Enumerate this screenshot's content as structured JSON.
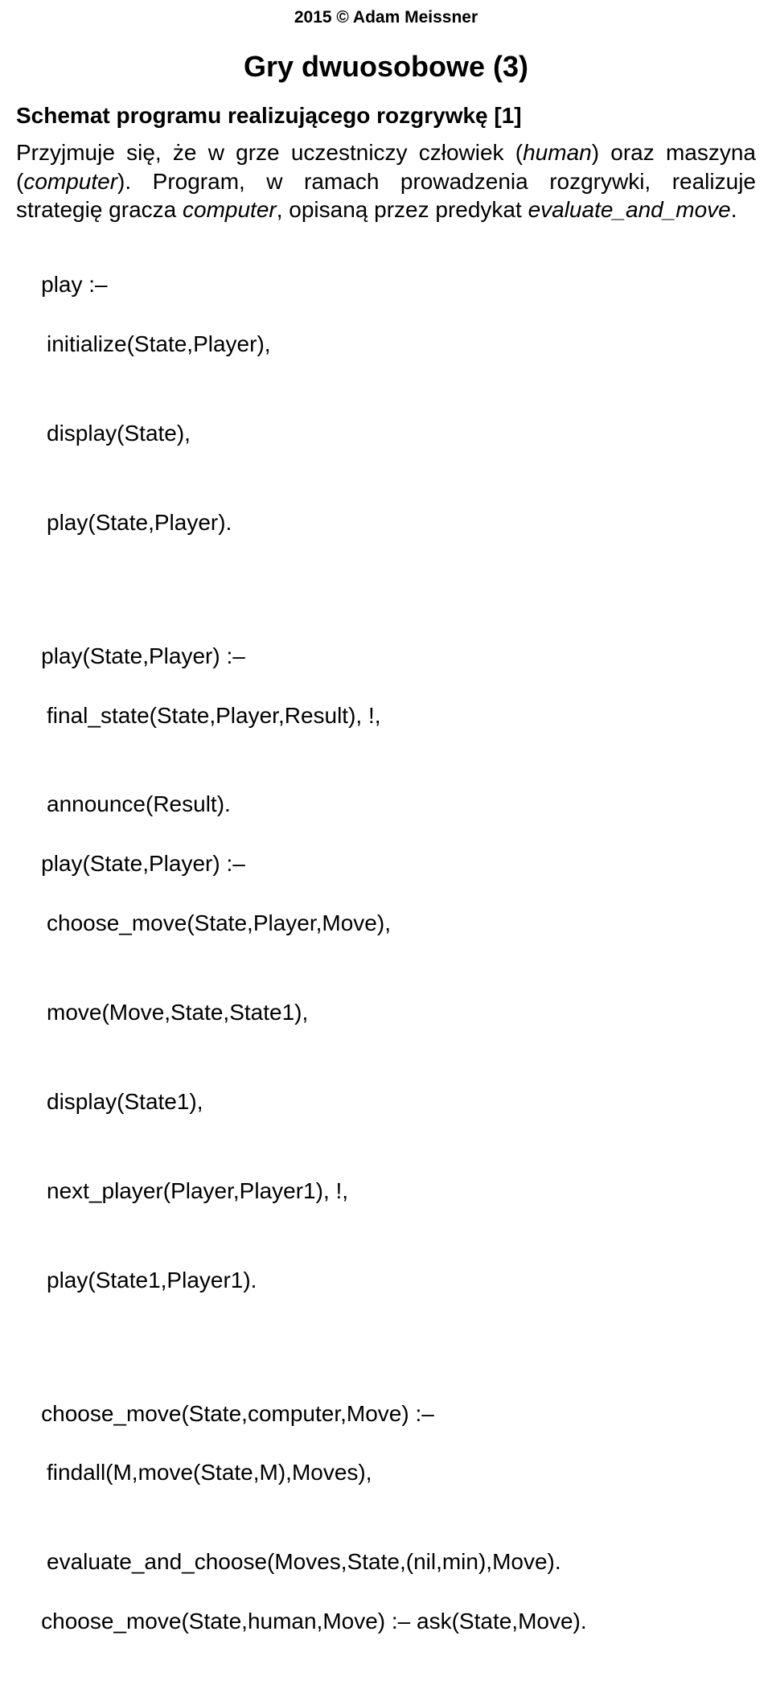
{
  "copyright": "2015 © Adam Meissner",
  "title": "Gry dwuosobowe (3)",
  "subtitle": "Schemat programu realizującego rozgrywkę [1]",
  "para": {
    "p1": "Przyjmuje się, że w grze uczestniczy człowiek (",
    "p2": "human",
    "p3": ") oraz maszyna (",
    "p4": "computer",
    "p5": "). Program, w ramach prowadzenia rozgrywki, realizuje strategię gracza ",
    "p6": "computer",
    "p7": ", opisaną przez predykat ",
    "p8": "evaluate_and_move",
    "p9": "."
  },
  "code1": {
    "l1": "play :–",
    "l2": "initialize(State,Player),",
    "l3": "display(State),",
    "l4": "play(State,Player)."
  },
  "code2": {
    "l1": "play(State,Player) :–",
    "l2": "final_state(State,Player,Result), !,",
    "l3": "announce(Result).",
    "l4": "play(State,Player) :–",
    "l5": "choose_move(State,Player,Move),",
    "l6": "move(Move,State,State1),",
    "l7": "display(State1),",
    "l8": "next_player(Player,Player1), !,",
    "l9": "play(State1,Player1)."
  },
  "code3": {
    "l1": "choose_move(State,computer,Move) :–",
    "l2": "findall(M,move(State,M),Moves),",
    "l3": "evaluate_and_choose(Moves,State,(nil,min),Move).",
    "l4": "choose_move(State,human,Move) :– ask(State,Move)."
  }
}
